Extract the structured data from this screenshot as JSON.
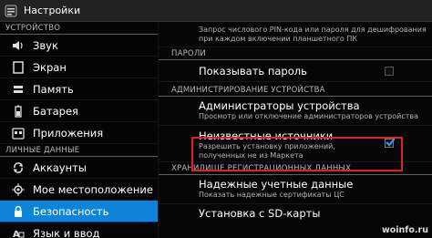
{
  "topbar": {
    "title": "Настройки",
    "icon": "settings-icon"
  },
  "sidebar": {
    "section_device": "УСТРОЙСТВО",
    "section_personal": "ЛИЧНЫЕ ДАННЫЕ",
    "items": [
      {
        "label": "Звук",
        "icon": "speaker-icon"
      },
      {
        "label": "Экран",
        "icon": "display-icon"
      },
      {
        "label": "Память",
        "icon": "storage-icon"
      },
      {
        "label": "Батарея",
        "icon": "battery-icon"
      },
      {
        "label": "Приложения",
        "icon": "apps-icon"
      },
      {
        "label": "Аккаунты",
        "icon": "sync-icon"
      },
      {
        "label": "Мое местоположение",
        "icon": "location-icon"
      },
      {
        "label": "Безопасность",
        "icon": "lock-icon"
      },
      {
        "label": "Язык и ввод",
        "icon": "language-icon"
      }
    ],
    "selected_index": 7,
    "accent": "#0f84d6"
  },
  "main": {
    "top_summary": "Запрос числового PIN-кода или пароля для дешифрования при каждом включении планшетного ПК",
    "section_passwords": "ПАРОЛИ",
    "show_password": {
      "title": "Показывать пароль",
      "checked": false
    },
    "section_admin": "АДМИНИСТРИРОВАНИЕ УСТРОЙСТВА",
    "device_admins": {
      "title": "Администраторы устройства",
      "summary": "Просмотр или отключение администраторов устройства"
    },
    "unknown_sources": {
      "title": "Неизвестные источники",
      "summary": "Разрешить установку приложений, полученных не из Маркета",
      "checked": true
    },
    "section_storage": "ХРАНИЛИЩЕ РЕГИСТРАЦИОННЫХ ДАННЫХ",
    "trusted_creds": {
      "title": "Надежные учетные данные",
      "summary": "Показать надежные сертификаты ЦС"
    },
    "install_sd": {
      "title": "Установка с SD-карты"
    }
  },
  "watermark": "woinfo.ru",
  "highlight_color": "#e0202a"
}
